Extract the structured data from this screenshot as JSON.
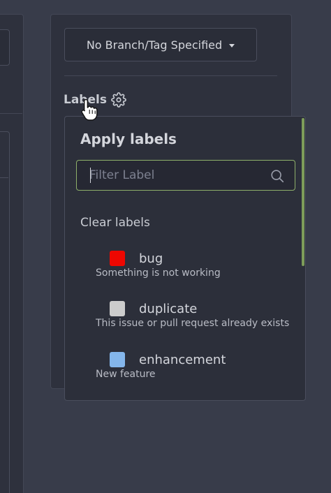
{
  "sidebar": {
    "branch_button": {
      "label": "No Branch/Tag Specified"
    },
    "labels_heading": "Labels"
  },
  "dropdown": {
    "title": "Apply labels",
    "filter": {
      "placeholder": "Filter Label",
      "value": ""
    },
    "clear_label": "Clear labels",
    "items": [
      {
        "name": "bug",
        "description": "Something is not working",
        "color": "#ee0701"
      },
      {
        "name": "duplicate",
        "description": "This issue or pull request already exists",
        "color": "#cccccc"
      },
      {
        "name": "enhancement",
        "description": "New feature",
        "color": "#84b6eb"
      }
    ]
  },
  "colors": {
    "accent_focus": "#8eb06a",
    "scrollbar": "#7d9c5a"
  },
  "icons": {
    "labels_settings": "gear-icon",
    "branch_dropdown": "caret-down-icon",
    "filter_search": "search-icon",
    "pointer": "hand-pointer-cursor-icon"
  }
}
